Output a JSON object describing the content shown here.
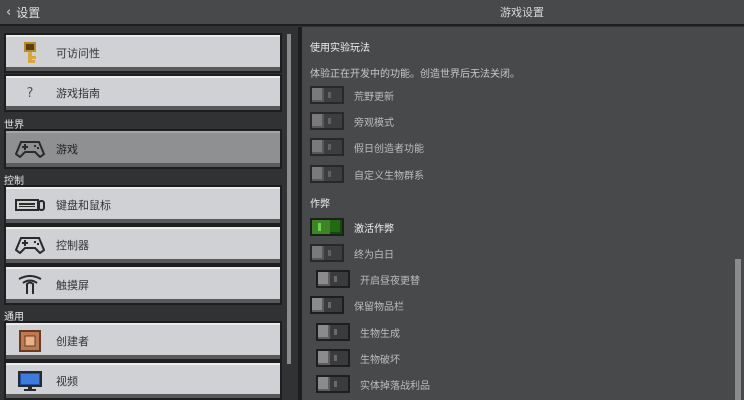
{
  "header": {
    "back_label": "设置",
    "title": "游戏设置"
  },
  "sidebar": {
    "sections": {
      "world": "世界",
      "controls": "控制",
      "general": "通用"
    },
    "items": [
      {
        "label": "可访问性",
        "icon": "key-icon"
      },
      {
        "label": "游戏指南",
        "icon": "question-icon"
      },
      {
        "label": "游戏",
        "icon": "gamepad-icon"
      },
      {
        "label": "键盘和鼠标",
        "icon": "keyboard-icon"
      },
      {
        "label": "控制器",
        "icon": "gamepad-icon"
      },
      {
        "label": "触摸屏",
        "icon": "touch-icon"
      },
      {
        "label": "创建者",
        "icon": "creator-icon"
      },
      {
        "label": "视频",
        "icon": "monitor-icon"
      }
    ],
    "question_glyph": "?"
  },
  "experiments": {
    "title": "使用实验玩法",
    "description": "体验正在开发中的功能。创造世界后无法关闭。",
    "toggles": [
      {
        "label": "荒野更新",
        "on": false
      },
      {
        "label": "旁观模式",
        "on": false
      },
      {
        "label": "假日创造者功能",
        "on": false
      },
      {
        "label": "自定义生物群系",
        "on": false
      }
    ]
  },
  "cheats": {
    "title": "作弊",
    "toggles": [
      {
        "label": "激活作弊",
        "on": true
      },
      {
        "label": "终为白日",
        "on": false
      },
      {
        "label": "开启昼夜更替",
        "on": false
      },
      {
        "label": "保留物品栏",
        "on": false
      },
      {
        "label": "生物生成",
        "on": false
      },
      {
        "label": "生物破坏",
        "on": false
      },
      {
        "label": "实体掉落战利品",
        "on": false
      }
    ]
  },
  "colors": {
    "toggle_on": "#3c8527",
    "panel_bg": "#48494a",
    "button_bg": "#d0d1d4",
    "selected_bg": "#8f9092"
  }
}
